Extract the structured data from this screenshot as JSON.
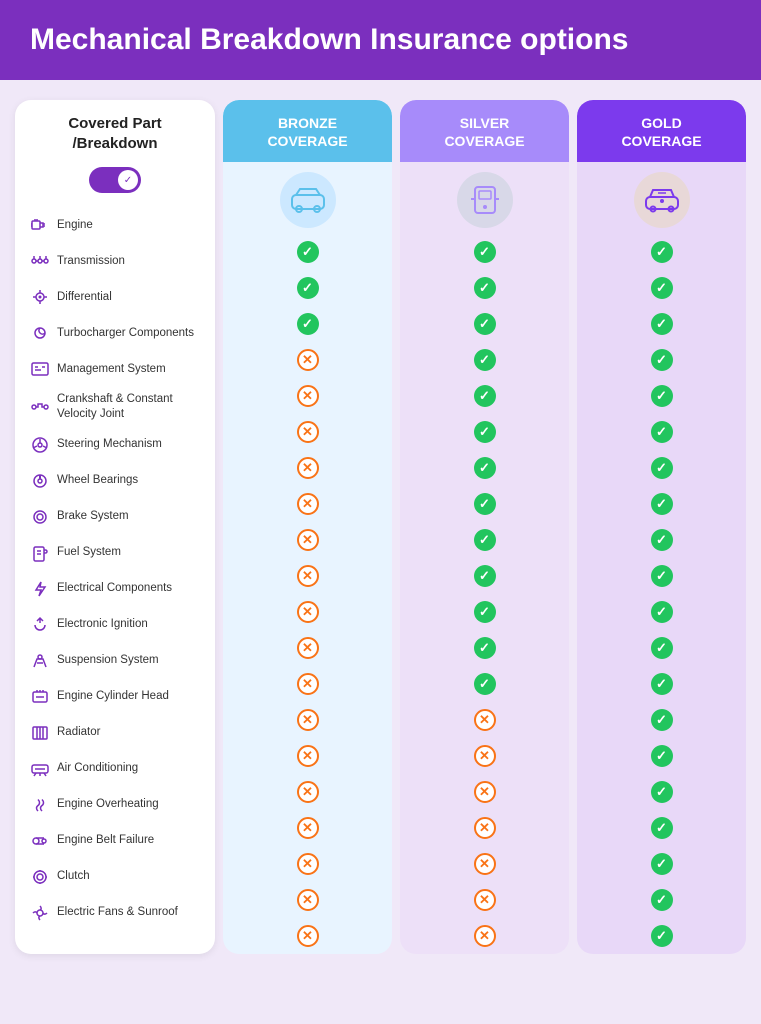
{
  "header": {
    "title": "Mechanical Breakdown Insurance options"
  },
  "leftColumn": {
    "heading": "Covered Part /Breakdown",
    "toggle_state": "on"
  },
  "parts": [
    {
      "label": "Engine",
      "icon": "🔧"
    },
    {
      "label": "Transmission",
      "icon": "⚙️"
    },
    {
      "label": "Differential",
      "icon": "🔩"
    },
    {
      "label": "Turbocharger Components",
      "icon": "🌀"
    },
    {
      "label": "Management System",
      "icon": "🖥️"
    },
    {
      "label": "Crankshaft & Constant Velocity Joint",
      "icon": "🔗"
    },
    {
      "label": "Steering Mechanism",
      "icon": "🎯"
    },
    {
      "label": "Wheel Bearings",
      "icon": "🔄"
    },
    {
      "label": "Brake System",
      "icon": "🛑"
    },
    {
      "label": "Fuel System",
      "icon": "⛽"
    },
    {
      "label": "Electrical Components",
      "icon": "⚡"
    },
    {
      "label": "Electronic Ignition",
      "icon": "🔌"
    },
    {
      "label": "Suspension System",
      "icon": "🚗"
    },
    {
      "label": "Engine Cylinder Head",
      "icon": "📦"
    },
    {
      "label": "Radiator",
      "icon": "🌡️"
    },
    {
      "label": "Air Conditioning",
      "icon": "❄️"
    },
    {
      "label": "Engine Overheating",
      "icon": "🔥"
    },
    {
      "label": "Engine Belt Failure",
      "icon": "🔁"
    },
    {
      "label": "Clutch",
      "icon": "⚙️"
    },
    {
      "label": "Electric Fans & Sunroof",
      "icon": "🌬️"
    }
  ],
  "columns": [
    {
      "id": "bronze",
      "title": "BRONZE COVERAGE",
      "icon": "🚗",
      "checks": [
        "yes",
        "yes",
        "yes",
        "no",
        "no",
        "no",
        "no",
        "no",
        "no",
        "no",
        "no",
        "no",
        "no",
        "no",
        "no",
        "no",
        "no",
        "no",
        "no",
        "no"
      ]
    },
    {
      "id": "silver",
      "title": "SILVER COVERAGE",
      "icon": "🚙",
      "checks": [
        "yes",
        "yes",
        "yes",
        "yes",
        "yes",
        "yes",
        "yes",
        "yes",
        "yes",
        "yes",
        "yes",
        "yes",
        "yes",
        "no",
        "no",
        "no",
        "no",
        "no",
        "no",
        "no"
      ]
    },
    {
      "id": "gold",
      "title": "GOLD COVERAGE",
      "icon": "🏎️",
      "checks": [
        "yes",
        "yes",
        "yes",
        "yes",
        "yes",
        "yes",
        "yes",
        "yes",
        "yes",
        "yes",
        "yes",
        "yes",
        "yes",
        "yes",
        "yes",
        "yes",
        "yes",
        "yes",
        "yes",
        "yes"
      ]
    }
  ]
}
